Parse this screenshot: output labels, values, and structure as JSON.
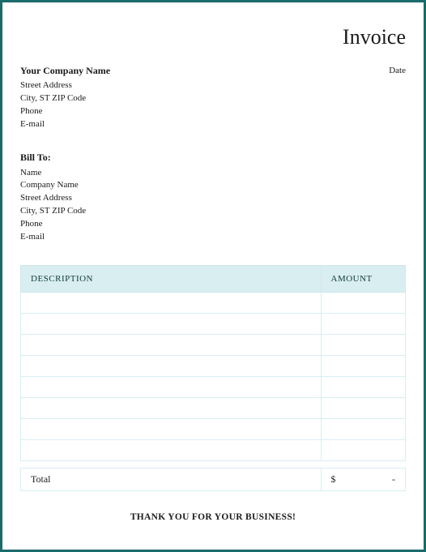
{
  "header": {
    "title": "Invoice",
    "date_label": "Date"
  },
  "company": {
    "name": "Your Company Name",
    "street": "Street Address",
    "city_st_zip": "City, ST  ZIP Code",
    "phone": "Phone",
    "email": "E-mail"
  },
  "billto": {
    "heading": "Bill To:",
    "name": "Name",
    "company": "Company Name",
    "street": "Street Address",
    "city_st_zip": "City, ST  ZIP Code",
    "phone": "Phone",
    "email": "E-mail"
  },
  "table": {
    "col_description": "DESCRIPTION",
    "col_amount": "AMOUNT",
    "rows": [
      {
        "description": "",
        "amount": ""
      },
      {
        "description": "",
        "amount": ""
      },
      {
        "description": "",
        "amount": ""
      },
      {
        "description": "",
        "amount": ""
      },
      {
        "description": "",
        "amount": ""
      },
      {
        "description": "",
        "amount": ""
      },
      {
        "description": "",
        "amount": ""
      },
      {
        "description": "",
        "amount": ""
      }
    ]
  },
  "total": {
    "label": "Total",
    "currency": "$",
    "value": "-"
  },
  "footer": {
    "thanks": "THANK YOU FOR YOUR BUSINESS!"
  }
}
